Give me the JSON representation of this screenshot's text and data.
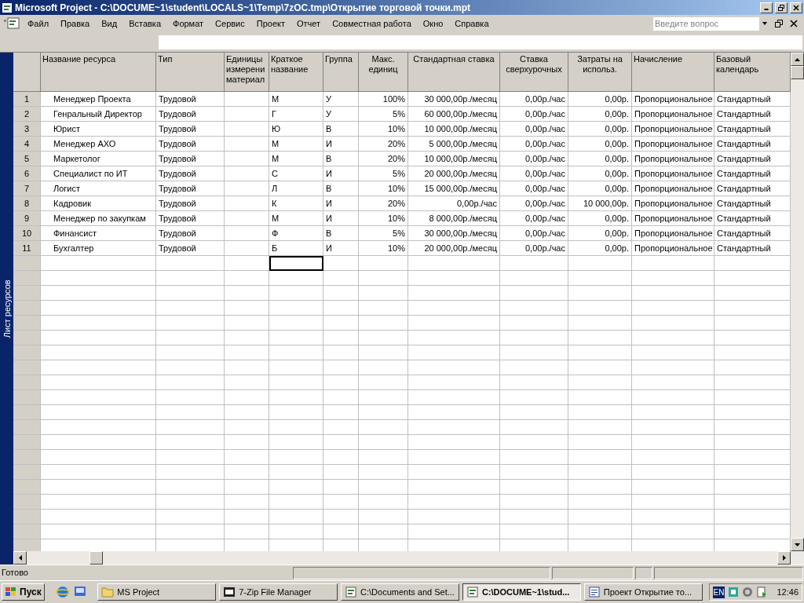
{
  "window": {
    "title": "Microsoft Project - C:\\DOCUME~1\\student\\LOCALS~1\\Temp\\7zOC.tmp\\Открытие торговой точки.mpt"
  },
  "menu": [
    "Файл",
    "Правка",
    "Вид",
    "Вставка",
    "Формат",
    "Сервис",
    "Проект",
    "Отчет",
    "Совместная работа",
    "Окно",
    "Справка"
  ],
  "help_search": {
    "placeholder": "Введите вопрос"
  },
  "view_bar": {
    "label": "Лист ресурсов"
  },
  "table": {
    "columns": [
      {
        "label": "Название ресурса"
      },
      {
        "label": "Тип"
      },
      {
        "label": "Единицы измерени материал"
      },
      {
        "label": "Краткое название"
      },
      {
        "label": "Группа"
      },
      {
        "label": "Макс. единиц"
      },
      {
        "label": "Стандартная ставка"
      },
      {
        "label": "Ставка сверхурочных"
      },
      {
        "label": "Затраты на использ."
      },
      {
        "label": "Начисление"
      },
      {
        "label": "Базовый календарь"
      }
    ],
    "rows": [
      {
        "number": "1",
        "cells": [
          "Менеджер Проекта",
          "Трудовой",
          "",
          "М",
          "У",
          "100%",
          "30 000,00р./месяц",
          "0,00р./час",
          "0,00р.",
          "Пропорциональное",
          "Стандартный"
        ]
      },
      {
        "number": "2",
        "cells": [
          "Генральный Директор",
          "Трудовой",
          "",
          "Г",
          "У",
          "5%",
          "60 000,00р./месяц",
          "0,00р./час",
          "0,00р.",
          "Пропорциональное",
          "Стандартный"
        ]
      },
      {
        "number": "3",
        "cells": [
          "Юрист",
          "Трудовой",
          "",
          "Ю",
          "В",
          "10%",
          "10 000,00р./месяц",
          "0,00р./час",
          "0,00р.",
          "Пропорциональное",
          "Стандартный"
        ]
      },
      {
        "number": "4",
        "cells": [
          "Менеджер АХО",
          "Трудовой",
          "",
          "М",
          "И",
          "20%",
          "5 000,00р./месяц",
          "0,00р./час",
          "0,00р.",
          "Пропорциональное",
          "Стандартный"
        ]
      },
      {
        "number": "5",
        "cells": [
          "Маркетолог",
          "Трудовой",
          "",
          "М",
          "В",
          "20%",
          "10 000,00р./месяц",
          "0,00р./час",
          "0,00р.",
          "Пропорциональное",
          "Стандартный"
        ]
      },
      {
        "number": "6",
        "cells": [
          "Специалист по ИТ",
          "Трудовой",
          "",
          "С",
          "И",
          "5%",
          "20 000,00р./месяц",
          "0,00р./час",
          "0,00р.",
          "Пропорциональное",
          "Стандартный"
        ]
      },
      {
        "number": "7",
        "cells": [
          "Логист",
          "Трудовой",
          "",
          "Л",
          "В",
          "10%",
          "15 000,00р./месяц",
          "0,00р./час",
          "0,00р.",
          "Пропорциональное",
          "Стандартный"
        ]
      },
      {
        "number": "8",
        "cells": [
          "Кадровик",
          "Трудовой",
          "",
          "К",
          "И",
          "20%",
          "0,00р./час",
          "0,00р./час",
          "10 000,00р.",
          "Пропорциональное",
          "Стандартный"
        ]
      },
      {
        "number": "9",
        "cells": [
          "Менеджер по закупкам",
          "Трудовой",
          "",
          "М",
          "И",
          "10%",
          "8 000,00р./месяц",
          "0,00р./час",
          "0,00р.",
          "Пропорциональное",
          "Стандартный"
        ]
      },
      {
        "number": "10",
        "cells": [
          "Финансист",
          "Трудовой",
          "",
          "Ф",
          "В",
          "5%",
          "30 000,00р./месяц",
          "0,00р./час",
          "0,00р.",
          "Пропорциональное",
          "Стандартный"
        ]
      },
      {
        "number": "11",
        "cells": [
          "Бухгалтер",
          "Трудовой",
          "",
          "Б",
          "И",
          "10%",
          "20 000,00р./месяц",
          "0,00р./час",
          "0,00р.",
          "Пропорциональное",
          "Стандартный"
        ]
      }
    ],
    "blank_row": {
      "short_name_cell_selected": true
    }
  },
  "status_bar": {
    "text": "Готово"
  },
  "taskbar": {
    "start": "Пуск",
    "tasks": [
      {
        "label": "MS Project",
        "kind": "folder",
        "selected": false
      },
      {
        "label": "7-Zip File Manager",
        "kind": "zip",
        "selected": false
      },
      {
        "label": "C:\\Documents and Set...",
        "kind": "project",
        "selected": false
      },
      {
        "label": "C:\\DOCUME~1\\stud...",
        "kind": "project",
        "selected": true
      },
      {
        "label": "Проект Открытие то...",
        "kind": "word",
        "selected": false
      }
    ],
    "language": "EN",
    "clock": "12:46"
  }
}
